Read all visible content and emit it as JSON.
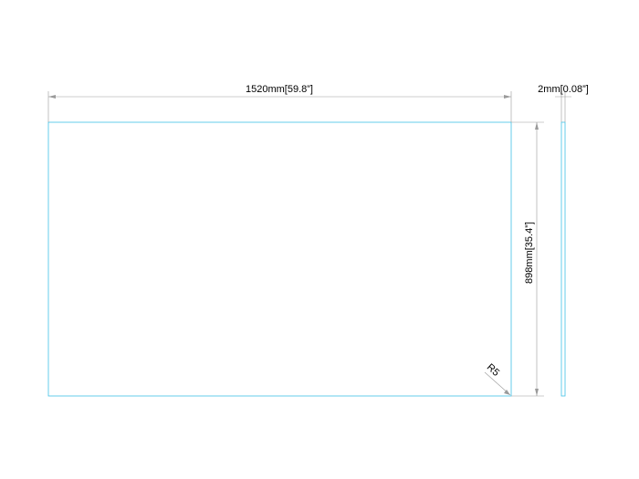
{
  "colors": {
    "outline": "#3fc1e6",
    "dimension": "#9a9a9a",
    "text": "#000000",
    "background": "#ffffff"
  },
  "dimensions": {
    "width_label": "1520mm[59.8”]",
    "height_label": "898mm[35.4”]",
    "thickness_label": "2mm[0.08”]",
    "corner_radius_label": "R5"
  }
}
